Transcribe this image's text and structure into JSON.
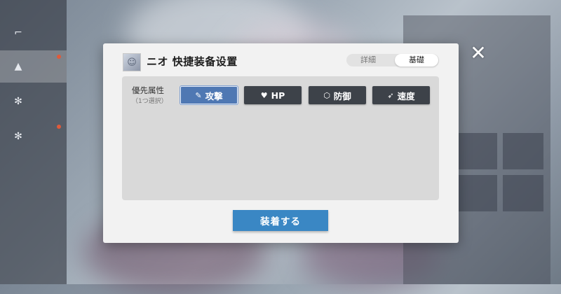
{
  "modal": {
    "title": "ニオ 快捷装备设置",
    "tabs": [
      "詳細",
      "基礎"
    ],
    "priority_label": "優先属性",
    "priority_sub": "（1つ選択）",
    "attributes": [
      {
        "label": "攻撃",
        "icon": "pencil-icon",
        "selected": true
      },
      {
        "label": "HP",
        "icon": "heart-icon",
        "selected": false
      },
      {
        "label": "防御",
        "icon": "hexagon-icon",
        "selected": false
      },
      {
        "label": "速度",
        "icon": "wing-icon",
        "selected": false
      }
    ],
    "equip_button": "装着する"
  },
  "close_icon": "✕",
  "colors": {
    "selected_attr": "#4f78b3",
    "attr_button": "#3d4249",
    "equip_button": "#3a87c4"
  }
}
